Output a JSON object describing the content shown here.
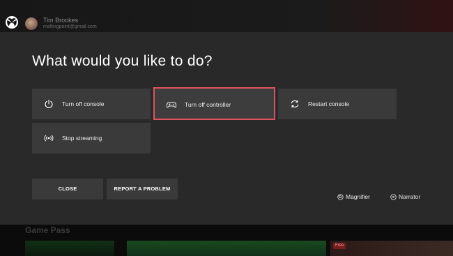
{
  "user": {
    "name": "Tim Brookes",
    "email": "meltingpoint@gmail.com"
  },
  "dialog": {
    "title": "What would you like to do?",
    "options": [
      {
        "label": "Turn off console",
        "icon": "power-icon"
      },
      {
        "label": "Turn off controller",
        "icon": "controller-icon",
        "selected": true
      },
      {
        "label": "Restart console",
        "icon": "restart-icon"
      },
      {
        "label": "Stop streaming",
        "icon": "streaming-icon"
      }
    ],
    "buttons": {
      "close": "CLOSE",
      "report": "REPORT A PROBLEM"
    },
    "accessibility": {
      "magnifier": "Magnifier",
      "narrator": "Narrator"
    }
  },
  "background": {
    "section_title": "Game Pass",
    "tile_badge": "Free"
  },
  "colors": {
    "dialog_bg": "#292929",
    "option_bg": "#3a3a3a",
    "focus_border": "#e0525e"
  }
}
